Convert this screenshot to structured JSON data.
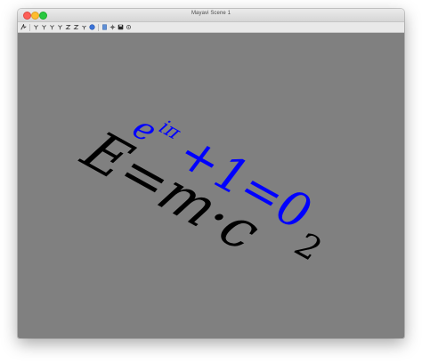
{
  "window": {
    "title": "Mayavi Scene 1"
  },
  "toolbar": {
    "buttons": [
      {
        "icon": "mayavi-logo-icon",
        "label": "Mayavi pipeline"
      },
      {
        "icon": "view-x-pos-icon",
        "label": "View along +X"
      },
      {
        "icon": "view-x-neg-icon",
        "label": "View along -X"
      },
      {
        "icon": "view-y-pos-icon",
        "label": "View along +Y"
      },
      {
        "icon": "view-y-neg-icon",
        "label": "View along -Y"
      },
      {
        "icon": "view-z-pos-icon",
        "label": "View along +Z"
      },
      {
        "icon": "view-z-neg-icon",
        "label": "View along -Z"
      },
      {
        "icon": "isometric-view-icon",
        "label": "Isometric view"
      },
      {
        "icon": "parallel-projection-icon",
        "label": "Toggle parallel projection"
      },
      {
        "icon": "axes-indicator-icon",
        "label": "Toggle axes indicator"
      },
      {
        "icon": "full-screen-icon",
        "label": "Full screen"
      },
      {
        "icon": "save-icon",
        "label": "Save"
      },
      {
        "icon": "configure-icon",
        "label": "Configure scene"
      }
    ]
  },
  "scene": {
    "background_color": "#808080",
    "formula_euler": {
      "base": "e",
      "exponent": "iπ",
      "rest": "+1=0",
      "color": "#0000ff"
    },
    "formula_einstein": {
      "text": "E=m·c",
      "exponent": "2",
      "color": "#000000"
    }
  }
}
